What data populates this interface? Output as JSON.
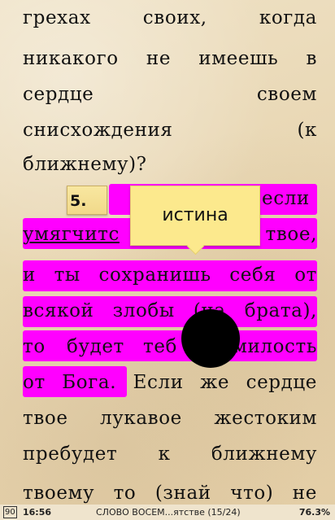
{
  "book": {
    "lines": [
      [
        "грехах",
        "своих,",
        "когда"
      ],
      [
        "никакого",
        "не",
        "имеешь",
        "в"
      ],
      [
        "сердце",
        "своем"
      ],
      [
        "снисхождения",
        "(к"
      ],
      [
        "ближнему)?"
      ],
      [
        "если"
      ],
      [
        "умягчитс",
        "твое,"
      ],
      [
        "и",
        "ты",
        "сохранишь",
        "себя",
        "от"
      ],
      [
        "всякой",
        "злобы",
        "(на",
        "брата),"
      ],
      [
        "то",
        "будет",
        "теб",
        "милость"
      ],
      [
        "от",
        "Бога.",
        "Если",
        "же",
        "сердце"
      ],
      [
        "твое",
        "лукавое",
        "жестоким"
      ],
      [
        "пребудет",
        "к",
        "ближнему"
      ],
      [
        "твоему",
        "то",
        "(знай",
        "что)",
        "не"
      ]
    ],
    "verse_number": "5.",
    "tooltip_text": "истина"
  },
  "status_bar": {
    "battery": "90",
    "time": "16:56",
    "title": "СЛОВО ВОСЕМ...ятстве (15/24)",
    "progress": "76.3%"
  },
  "colors": {
    "highlight": "#ff00ff",
    "tooltip": "#fce98d",
    "page": "#e8d6b2"
  }
}
